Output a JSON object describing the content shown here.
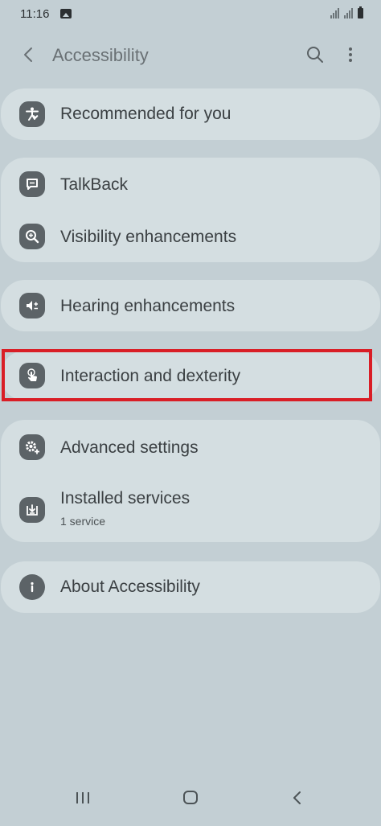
{
  "status_bar": {
    "time": "11:16"
  },
  "header": {
    "title": "Accessibility"
  },
  "groups": [
    {
      "items": [
        {
          "label": "Recommended for you",
          "icon": "accessibility-person-icon"
        }
      ]
    },
    {
      "items": [
        {
          "label": "TalkBack",
          "icon": "talkback-icon"
        },
        {
          "label": "Visibility enhancements",
          "icon": "magnifier-icon"
        }
      ]
    },
    {
      "items": [
        {
          "label": "Hearing enhancements",
          "icon": "hearing-icon"
        }
      ]
    },
    {
      "items": [
        {
          "label": "Interaction and dexterity",
          "icon": "touch-hand-icon"
        }
      ]
    },
    {
      "items": [
        {
          "label": "Advanced settings",
          "icon": "gear-plus-icon"
        },
        {
          "label": "Installed services",
          "sublabel": "1 service",
          "icon": "download-icon"
        }
      ]
    },
    {
      "items": [
        {
          "label": "About Accessibility",
          "icon": "info-icon"
        }
      ]
    }
  ],
  "colors": {
    "background": "#c3cfd4",
    "card": "#d4dee1",
    "icon_bg": "#5c6367",
    "highlight": "#d91e26"
  }
}
